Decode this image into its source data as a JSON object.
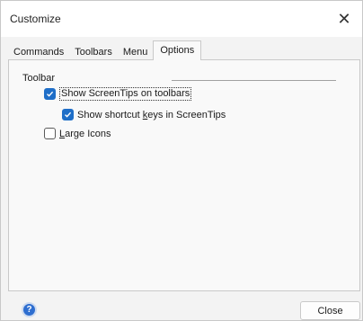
{
  "window": {
    "title": "Customize",
    "close_glyph": "✕"
  },
  "tabs": [
    {
      "label": "Commands",
      "active": false
    },
    {
      "label": "Toolbars",
      "active": false
    },
    {
      "label": "Menu",
      "active": false
    },
    {
      "label": "Options",
      "active": true
    }
  ],
  "options": {
    "group_label": "Toolbar",
    "checkboxes": [
      {
        "label_pre": "Show ScreenTips on toolbars",
        "label_u": "",
        "label_post": "",
        "checked": true
      },
      {
        "label_pre": "Show shortcut ",
        "label_u": "k",
        "label_post": "eys in ScreenTips",
        "checked": true
      },
      {
        "label_pre": "",
        "label_u": "L",
        "label_post": "arge Icons",
        "checked": false
      }
    ]
  },
  "footer": {
    "help_icon": "help-icon",
    "help_glyph": "?",
    "close_label": "Close"
  },
  "colors": {
    "accent": "#1e6ec8",
    "background": "#f3f3f3",
    "panel": "#f9f9f9"
  }
}
